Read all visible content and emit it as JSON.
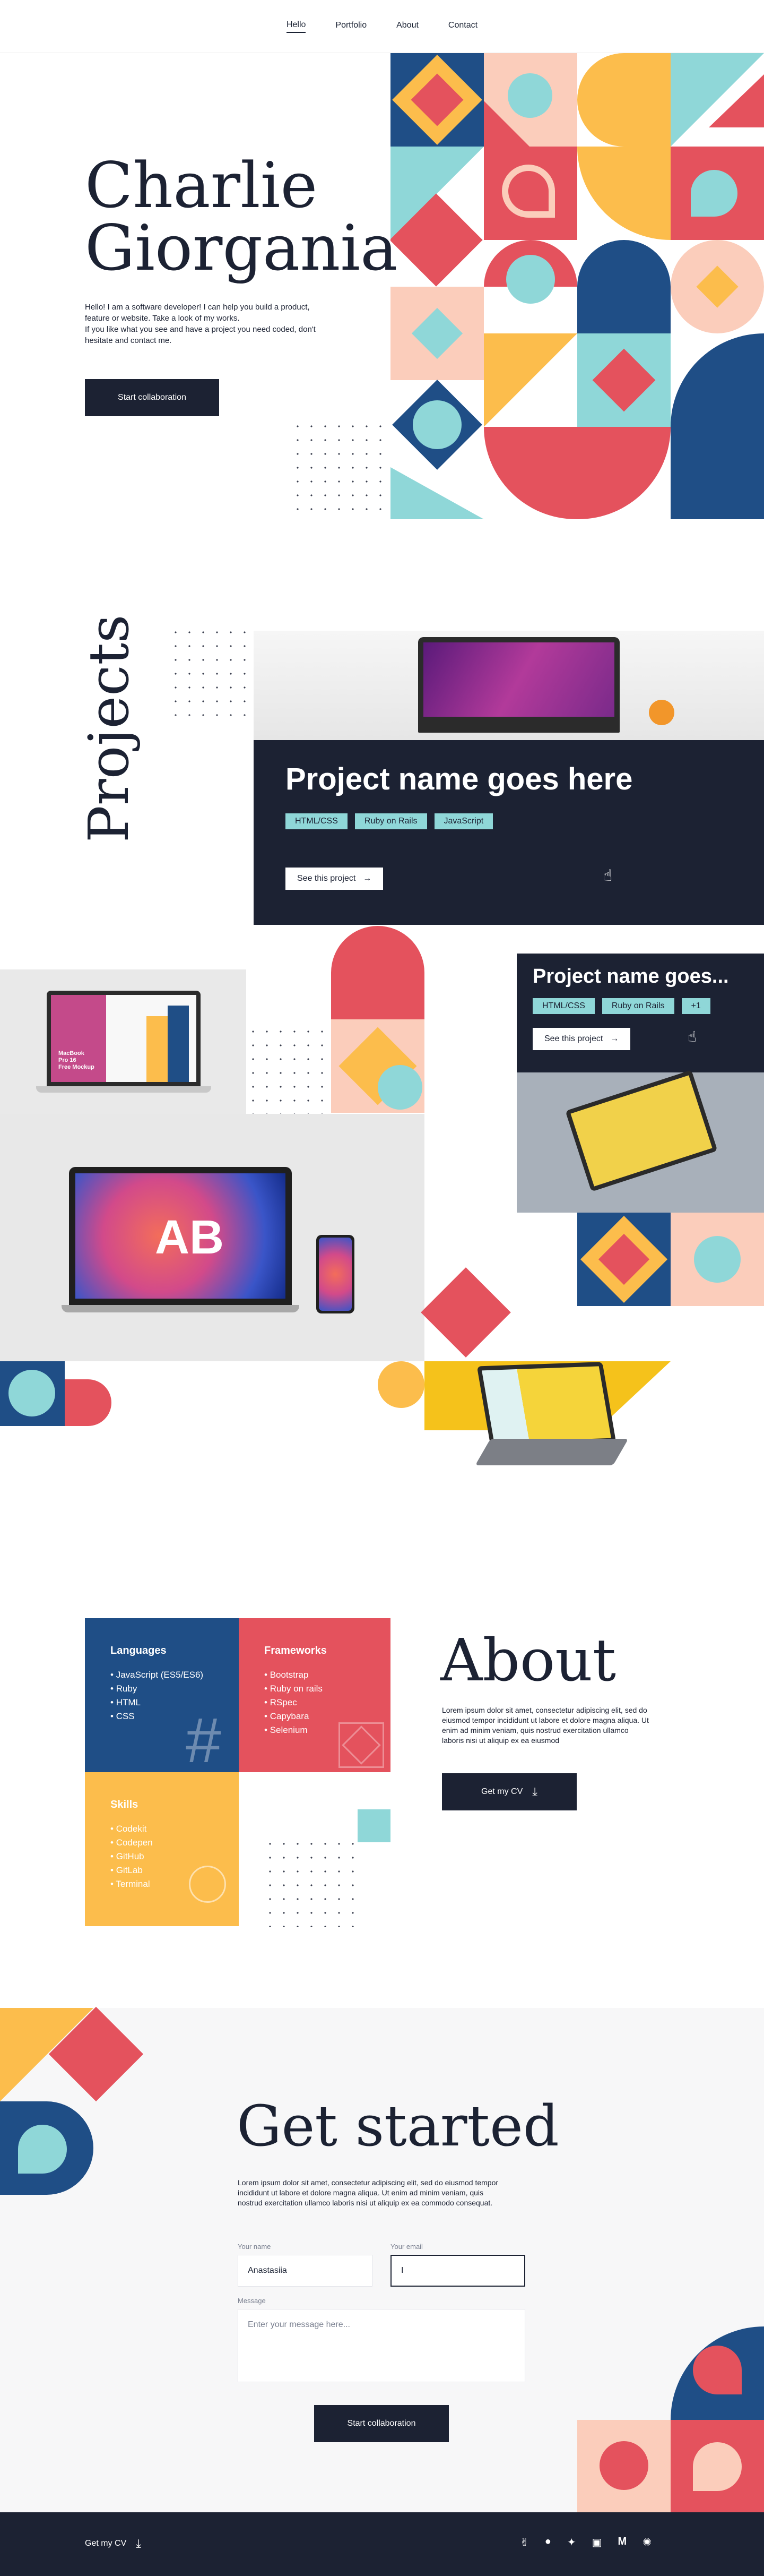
{
  "nav": {
    "items": [
      "Hello",
      "Portfolio",
      "About",
      "Contact"
    ]
  },
  "hero": {
    "name_line1": "Charlie",
    "name_line2": "Giorgania",
    "intro_1": "Hello! I am a software developer! I can help you build a product,",
    "intro_2": "feature or website. Take a look of my works.",
    "intro_3": "If you like what you see and have a project you need coded, don't",
    "intro_4": "hesitate and contact me.",
    "cta": "Start collaboration"
  },
  "projects": {
    "heading": "Projects",
    "card1": {
      "title": "Project name goes here",
      "tags": [
        "HTML/CSS",
        "Ruby on Rails",
        "JavaScript"
      ],
      "button": "See this project"
    },
    "card2": {
      "title": "Project name goes...",
      "tags": [
        "HTML/CSS",
        "Ruby on Rails",
        "+1"
      ],
      "button": "See this project"
    },
    "mockup_label_1": "MacBook",
    "mockup_label_2": "Pro 16",
    "mockup_label_3": "Free Mockup"
  },
  "about": {
    "heading": "About",
    "para_1": "Lorem ipsum dolor sit amet, consectetur adipiscing elit, sed do",
    "para_2": "eiusmod tempor incididunt ut labore et dolore magna aliqua. Ut",
    "para_3": "enim ad minim veniam, quis nostrud exercitation ullamco",
    "para_4": "laboris nisi ut aliquip ex ea eiusmod",
    "cv_button": "Get my CV",
    "languages": {
      "title": "Languages",
      "items": [
        "JavaScript (ES5/ES6)",
        "Ruby",
        "HTML",
        "CSS"
      ]
    },
    "frameworks": {
      "title": "Frameworks",
      "items": [
        "Bootstrap",
        "Ruby on rails",
        "RSpec",
        "Capybara",
        "Selenium"
      ]
    },
    "skills": {
      "title": "Skills",
      "items": [
        "Codekit",
        "Codepen",
        "GitHub",
        "GitLab",
        "Terminal"
      ]
    }
  },
  "contact": {
    "heading": "Get started",
    "para_1": "Lorem ipsum dolor sit amet, consectetur adipiscing elit, sed do eiusmod tempor",
    "para_2": "incididunt ut labore et dolore magna aliqua. Ut enim ad minim veniam, quis",
    "para_3": "nostrud exercitation ullamco laboris nisi ut aliquip ex ea commodo consequat.",
    "name_label": "Your name",
    "name_value": "Anastasiia",
    "email_label": "Your email",
    "email_value": "I",
    "message_label": "Message",
    "message_placeholder": "Enter your message here...",
    "submit": "Start collaboration"
  },
  "footer": {
    "cv_link": "Get my CV"
  },
  "colors": {
    "navy": "#1f4e86",
    "red": "#e4525d",
    "teal": "#8fd7d8",
    "yellow": "#fcbd4c",
    "peach": "#fbcdbb",
    "dark": "#1c2233"
  }
}
